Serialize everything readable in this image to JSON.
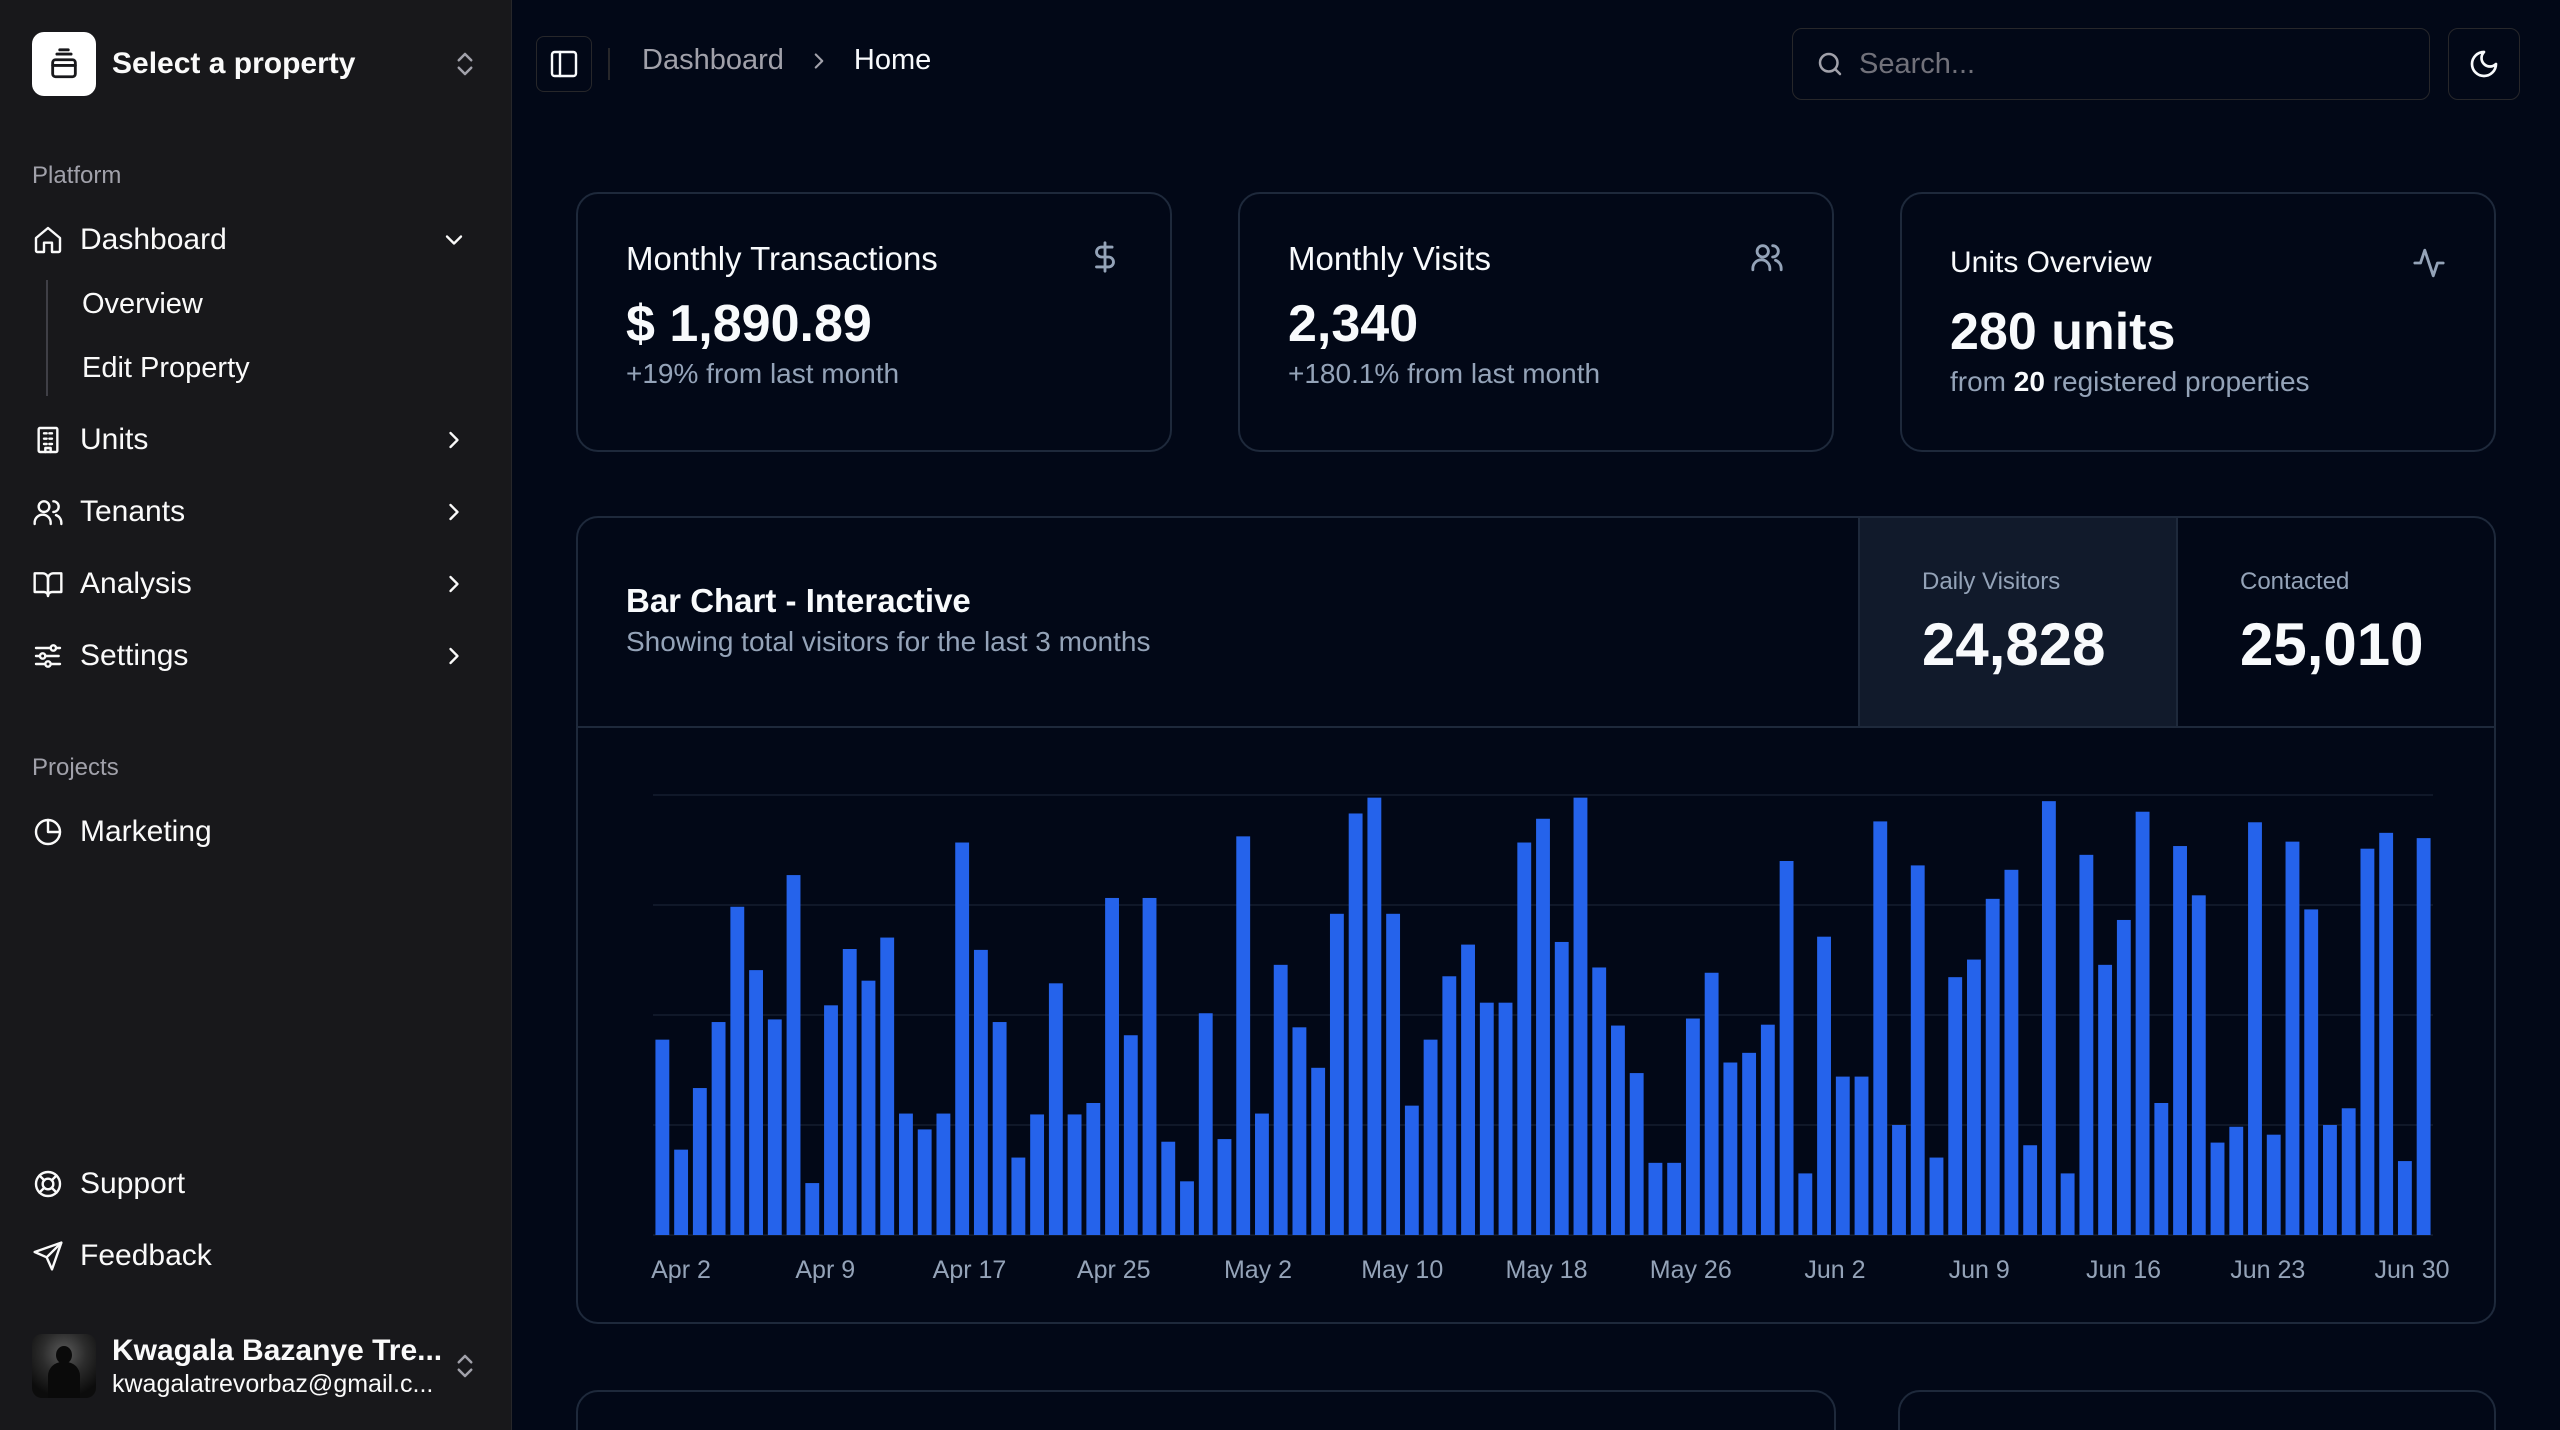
{
  "sidebar": {
    "property_switcher": "Select a property",
    "groups": {
      "platform": "Platform",
      "projects": "Projects"
    },
    "dashboard": {
      "label": "Dashboard",
      "subitems": [
        "Overview",
        "Edit Property"
      ]
    },
    "items": [
      {
        "label": "Units",
        "icon": "building-icon"
      },
      {
        "label": "Tenants",
        "icon": "users-icon"
      },
      {
        "label": "Analysis",
        "icon": "book-open-icon"
      },
      {
        "label": "Settings",
        "icon": "sliders-icon"
      }
    ],
    "projects": [
      {
        "label": "Marketing",
        "icon": "pie-chart-icon"
      }
    ],
    "footer": [
      {
        "label": "Support",
        "icon": "lifebuoy-icon"
      },
      {
        "label": "Feedback",
        "icon": "send-icon"
      }
    ],
    "user": {
      "name": "Kwagala Bazanye Tre...",
      "email": "kwagalatrevorbaz@gmail.c..."
    }
  },
  "header": {
    "breadcrumb": [
      "Dashboard",
      "Home"
    ],
    "search_placeholder": "Search..."
  },
  "stats": [
    {
      "title": "Monthly Transactions",
      "value": "$ 1,890.89",
      "note": "+19% from last month",
      "icon": "dollar-icon"
    },
    {
      "title": "Monthly Visits",
      "value": "2,340",
      "note": "+180.1% from last month",
      "icon": "users-icon"
    },
    {
      "title": "Units Overview",
      "value": "280 units",
      "note_prefix": "from ",
      "note_strong": "20",
      "note_suffix": " registered properties",
      "icon": "activity-icon"
    }
  ],
  "chart_card": {
    "title": "Bar Chart - Interactive",
    "subtitle": "Showing total visitors for the last 3 months",
    "kpis": [
      {
        "label": "Daily Visitors",
        "value": "24,828",
        "active": true
      },
      {
        "label": "Contacted",
        "value": "25,010",
        "active": false
      }
    ]
  },
  "colors": {
    "background": "#020817",
    "sidebar": "#18181b",
    "bar": "#2563eb",
    "border": "#1e293b",
    "muted_text": "#94a3b8"
  },
  "chart_data": {
    "type": "bar",
    "title": "",
    "xlabel": "",
    "ylabel": "",
    "grid": true,
    "ylim": [
      0,
      500
    ],
    "x_tick_labels": [
      "Apr 2",
      "Apr 9",
      "Apr 17",
      "Apr 25",
      "May 2",
      "May 10",
      "May 18",
      "May 26",
      "Jun 2",
      "Jun 9",
      "Jun 16",
      "Jun 23",
      "Jun 30"
    ],
    "series": [
      {
        "values": [
          222,
          97,
          167,
          242,
          373,
          301,
          245,
          409,
          59,
          261,
          325,
          289,
          338,
          138,
          120,
          138,
          446,
          324,
          242,
          88,
          137,
          286,
          137,
          150,
          383,
          227,
          383,
          106,
          61,
          252,
          109,
          453,
          138,
          307,
          236,
          190,
          365,
          479,
          497,
          365,
          147,
          222,
          294,
          330,
          264,
          264,
          446,
          473,
          333,
          497,
          304,
          238,
          184,
          82,
          82,
          246,
          298,
          196,
          207,
          239,
          425,
          70,
          339,
          180,
          180,
          470,
          125,
          420,
          88,
          293,
          313,
          382,
          415,
          102,
          493,
          70,
          432,
          307,
          358,
          481,
          150,
          442,
          386,
          105,
          123,
          469,
          114,
          447,
          370,
          125,
          144,
          439,
          457,
          84,
          451
        ]
      }
    ]
  }
}
